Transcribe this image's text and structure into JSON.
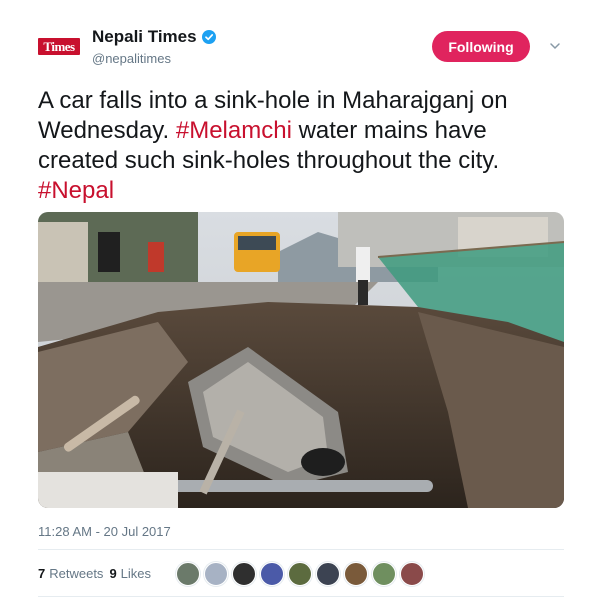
{
  "header": {
    "avatar_text": "Times",
    "display_name": "Nepali Times",
    "handle": "@nepalitimes",
    "follow_label": "Following"
  },
  "tweet": {
    "text_part1": "A car falls into a sink-hole in Maharajganj on Wednesday. ",
    "hashtag1": "#Melamchi",
    "text_part2": " water mains have created such sink-holes throughout the city. ",
    "hashtag2": "#Nepal"
  },
  "meta": {
    "timestamp": "11:28 AM - 20 Jul 2017",
    "retweets_count": "7",
    "retweets_label": "Retweets",
    "likes_count": "9",
    "likes_label": "Likes"
  },
  "icons": {
    "verified": "verified-badge-icon",
    "chevron": "chevron-down-icon"
  },
  "likers": [
    "#6b7a6a",
    "#a7b2c4",
    "#2f2f2f",
    "#4b5aa8",
    "#5c6b3f",
    "#3c4352",
    "#7a5a3a",
    "#6f8f5f",
    "#8a4a4a"
  ],
  "colors": {
    "brand_red": "#c8102e",
    "follow_pink": "#e0245e",
    "muted": "#657786"
  }
}
